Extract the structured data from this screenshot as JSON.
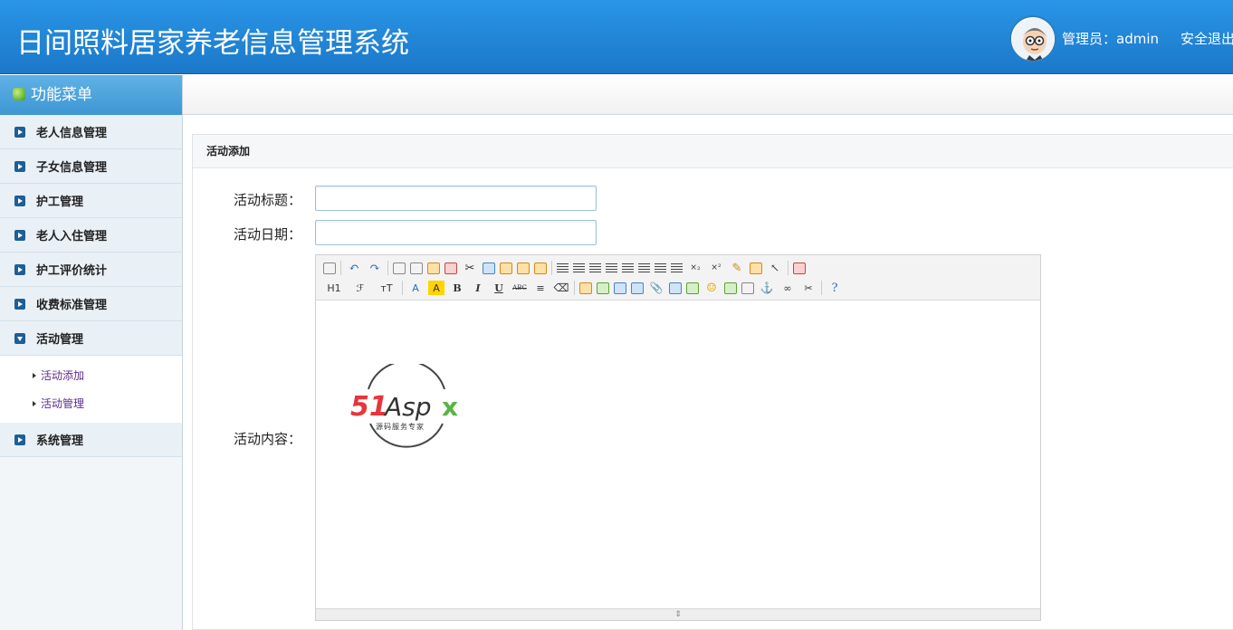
{
  "header": {
    "title": "日间照料居家养老信息管理系统",
    "admin_label": "管理员：admin",
    "logout": "安全退出"
  },
  "sidebar": {
    "heading": "功能菜单",
    "items": [
      {
        "label": "老人信息管理"
      },
      {
        "label": "子女信息管理"
      },
      {
        "label": "护工管理"
      },
      {
        "label": "老人入住管理"
      },
      {
        "label": "护工评价统计"
      },
      {
        "label": "收费标准管理"
      },
      {
        "label": "活动管理",
        "expanded": true,
        "children": [
          {
            "label": "活动添加"
          },
          {
            "label": "活动管理"
          }
        ]
      },
      {
        "label": "系统管理"
      }
    ]
  },
  "panel": {
    "title": "活动添加",
    "fields": {
      "title_label": "活动标题：",
      "date_label": "活动日期：",
      "content_label": "活动内容："
    },
    "title_value": "",
    "date_value": ""
  },
  "editor": {
    "toolbar_text": {
      "heading": "H1",
      "font": "ℱ",
      "size": "тT",
      "bold": "B",
      "italic": "I",
      "underline": "U",
      "strike": "ABC"
    },
    "logo": {
      "brand": "51Aspx",
      "brand_red": "51",
      "brand_dark": "Asp",
      "brand_green": "x",
      "tagline": "源码服务专家"
    }
  },
  "colors": {
    "header": "#1f82d3",
    "menu_head": "#4aa2dc",
    "submenu_link": "#5b2c8d",
    "logo_red": "#e8343c",
    "logo_green": "#58b445"
  }
}
